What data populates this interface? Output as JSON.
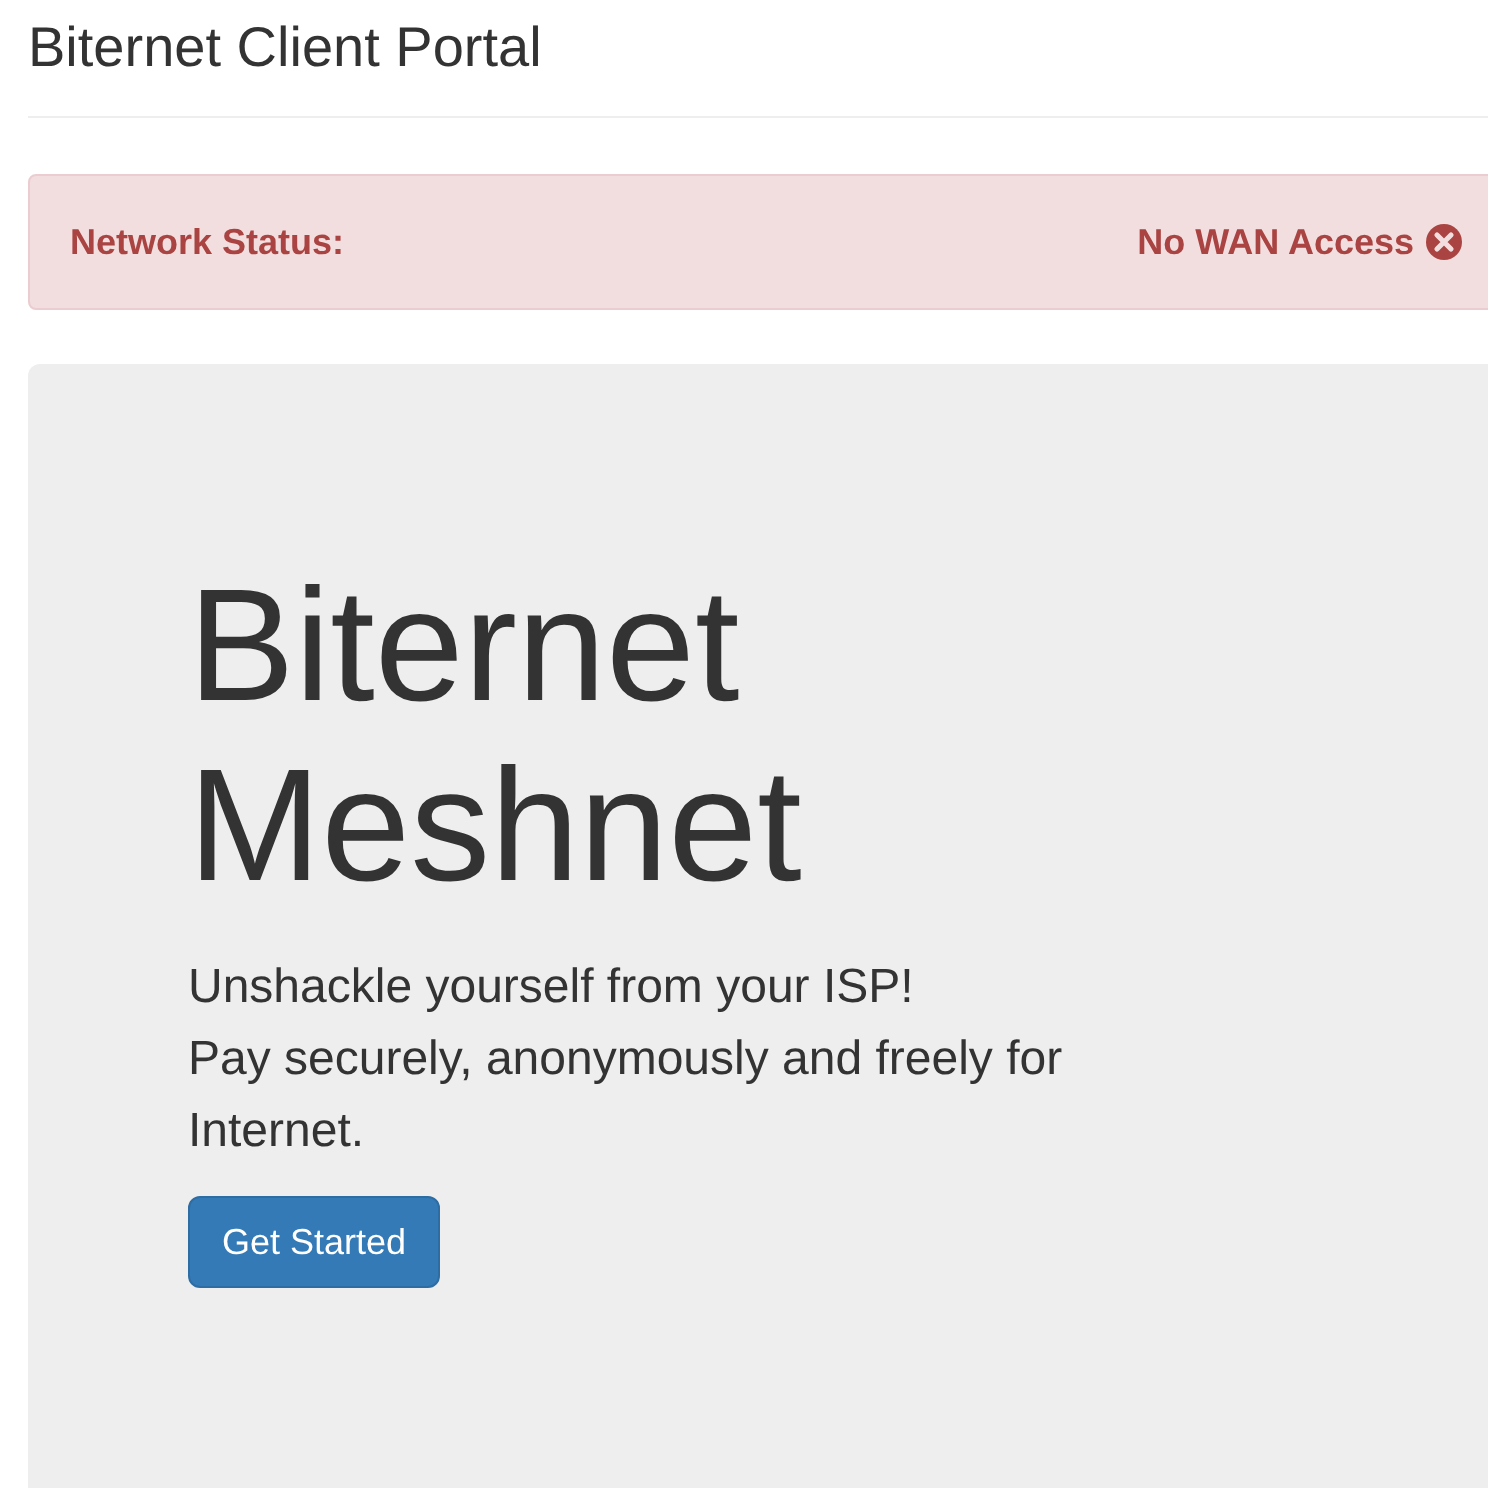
{
  "page_title": "Biternet Client Portal",
  "status_alert": {
    "label": "Network Status:",
    "value": "No WAN Access",
    "error": true
  },
  "hero": {
    "heading_lines": [
      "Biternet",
      "Meshnet"
    ],
    "lines": [
      "Unshackle yourself from your ISP!",
      "Pay securely, anonymously and freely for Internet."
    ],
    "button": "Get Started"
  }
}
